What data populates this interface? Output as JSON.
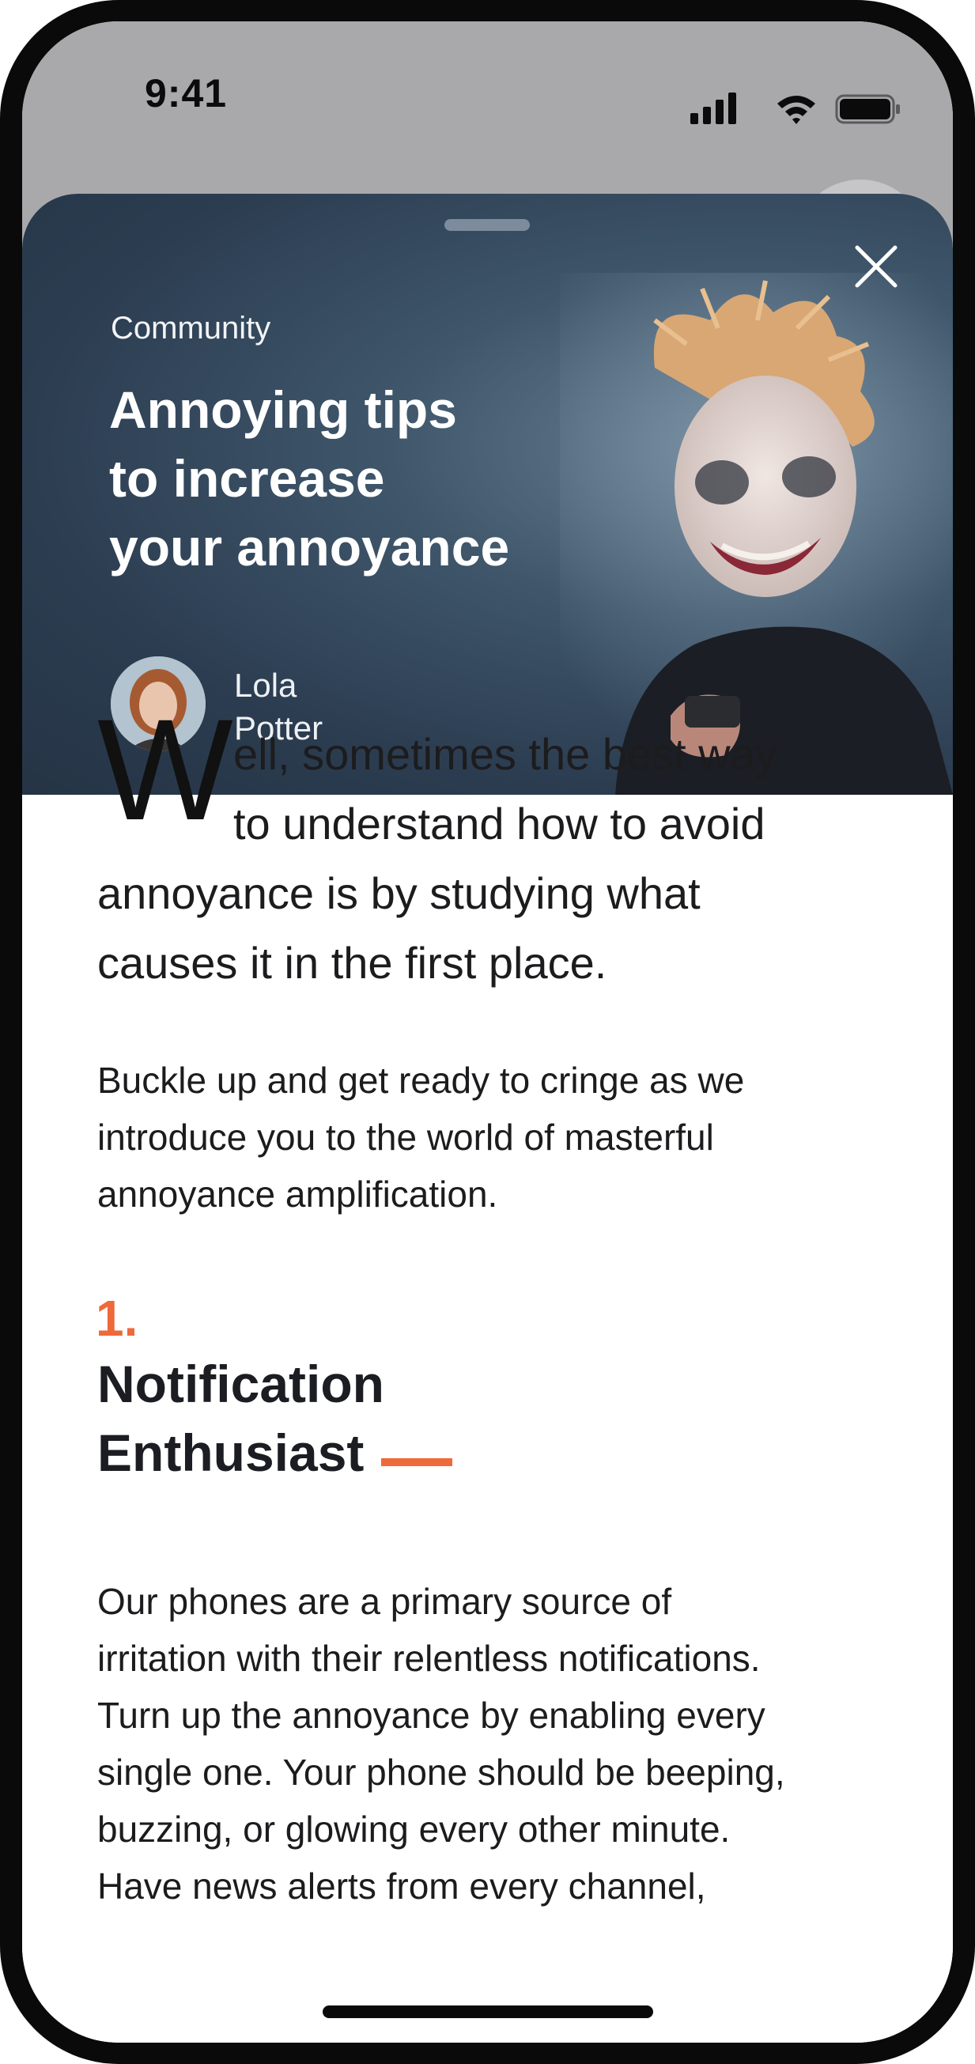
{
  "status_bar": {
    "time": "9:41"
  },
  "header": {
    "category": "Community",
    "title_lines": [
      "Annoying tips",
      "to increase",
      "your annoyance"
    ],
    "author": {
      "first_name": "Lola",
      "last_name": "Potter"
    }
  },
  "article": {
    "drop_cap": "W",
    "lead_lines": [
      "ell, sometimes the best way",
      "to understand how to avoid",
      "annoyance is by studying what",
      "causes it in the first place."
    ],
    "intro_lines": [
      "Buckle up and get ready to cringe as we",
      "introduce you to the world of masterful",
      "annoyance amplification."
    ],
    "sections": [
      {
        "number": "1.",
        "heading_lines": [
          "Notification",
          "Enthusiast"
        ],
        "body_lines": [
          "Our phones are a primary source of",
          "irritation with their relentless notifications.",
          "Turn up the annoyance by enabling every",
          "single one. Your phone should be beeping,",
          "buzzing, or glowing every other minute.",
          "Have news alerts from every channel,"
        ]
      }
    ]
  },
  "colors": {
    "accent": "#ee6a3a",
    "hero_background": "#3f566b",
    "text": "#1c1c1e",
    "status_area": "#a9a9ac"
  },
  "icons": {
    "close": "close-icon",
    "signal": "cellular-signal-icon",
    "wifi": "wifi-icon",
    "battery": "battery-icon"
  }
}
